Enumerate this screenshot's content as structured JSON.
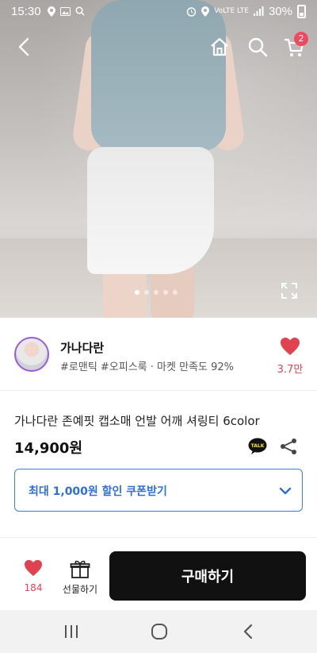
{
  "status_bar": {
    "time": "15:30",
    "network": "VoLTE LTE",
    "battery": "30%"
  },
  "product": {
    "title": "가나다란 존예핏 캡소매 언발 어깨 셔링티 6color",
    "price": "14,900원",
    "image_count": 5,
    "active_image_index": 0
  },
  "cart": {
    "badge_count": "2"
  },
  "seller": {
    "name": "가나다란",
    "tags": "#로맨틱 #오피스룩 · 마켓 만족도 92%",
    "likes": "3.7만"
  },
  "coupon": {
    "label": "최대 1,000원 할인 쿠폰받기"
  },
  "bottom_bar": {
    "wish_count": "184",
    "gift_label": "선물하기",
    "buy_label": "구매하기"
  },
  "colors": {
    "accent_red": "#e0424f",
    "coupon_blue": "#2f6fd6",
    "buy_button": "#111111",
    "seller_ring": "#9b5bd6"
  },
  "icons": [
    "back-icon",
    "home-icon",
    "search-icon",
    "cart-icon",
    "expand-icon",
    "heart-icon",
    "kakaotalk-icon",
    "share-icon",
    "chevron-down-icon",
    "gift-icon",
    "recent-apps-icon",
    "home-button-icon",
    "back-button-icon"
  ]
}
